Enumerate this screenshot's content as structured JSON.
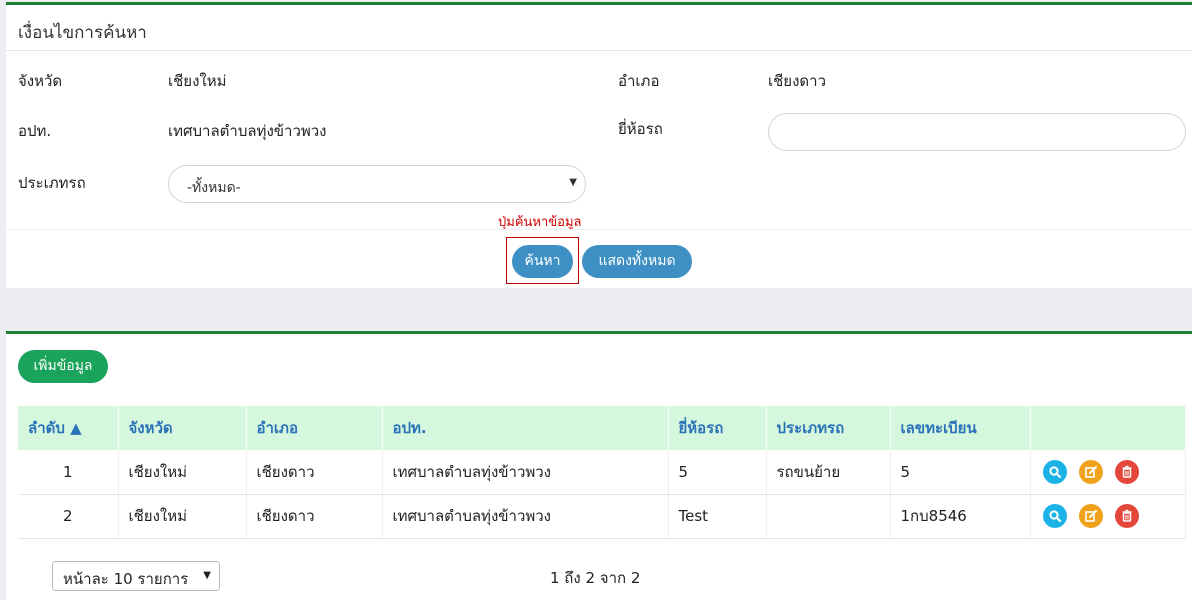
{
  "search_panel": {
    "title": "เงื่อนไขการค้นหา",
    "province_label": "จังหวัด",
    "province_value": "เชียงใหม่",
    "district_label": "อำเภอ",
    "district_value": "เชียงดาว",
    "lao_label": "อปท.",
    "lao_value": "เทศบาลตำบลทุ่งข้าวพวง",
    "brand_label": "ยี่ห้อรถ",
    "brand_value": "",
    "type_label": "ประเภทรถ",
    "type_selected": "-ทั้งหมด-",
    "hint": "ปุ่มค้นหาข้อมูล",
    "search_button": "ค้นหา",
    "show_all_button": "แสดงทั้งหมด"
  },
  "result_panel": {
    "add_button": "เพิ่มข้อมูล",
    "columns": [
      "ลำดับ ▲",
      "จังหวัด",
      "อำเภอ",
      "อปท.",
      "ยี่ห้อรถ",
      "ประเภทรถ",
      "เลขทะเบียน",
      ""
    ],
    "rows": [
      [
        "1",
        "เชียงใหม่",
        "เชียงดาว",
        "เทศบาลตำบลทุ่งข้าวพวง",
        "5",
        "รถขนย้าย",
        "5"
      ],
      [
        "2",
        "เชียงใหม่",
        "เชียงดาว",
        "เทศบาลตำบลทุ่งข้าวพวง",
        "Test",
        "",
        "1กบ8546"
      ]
    ],
    "row_actions": [
      "search-icon",
      "edit-icon",
      "trash-icon"
    ],
    "page_size_label": "หน้าละ 10 รายการ",
    "page_info": "1 ถึง 2 จาก 2"
  },
  "colors": {
    "accent_green": "#1e7e34",
    "button_blue": "#3d8fc4",
    "header_bg": "#d4f7dd",
    "header_text": "#2b73b9",
    "hint_red": "#d10000"
  }
}
